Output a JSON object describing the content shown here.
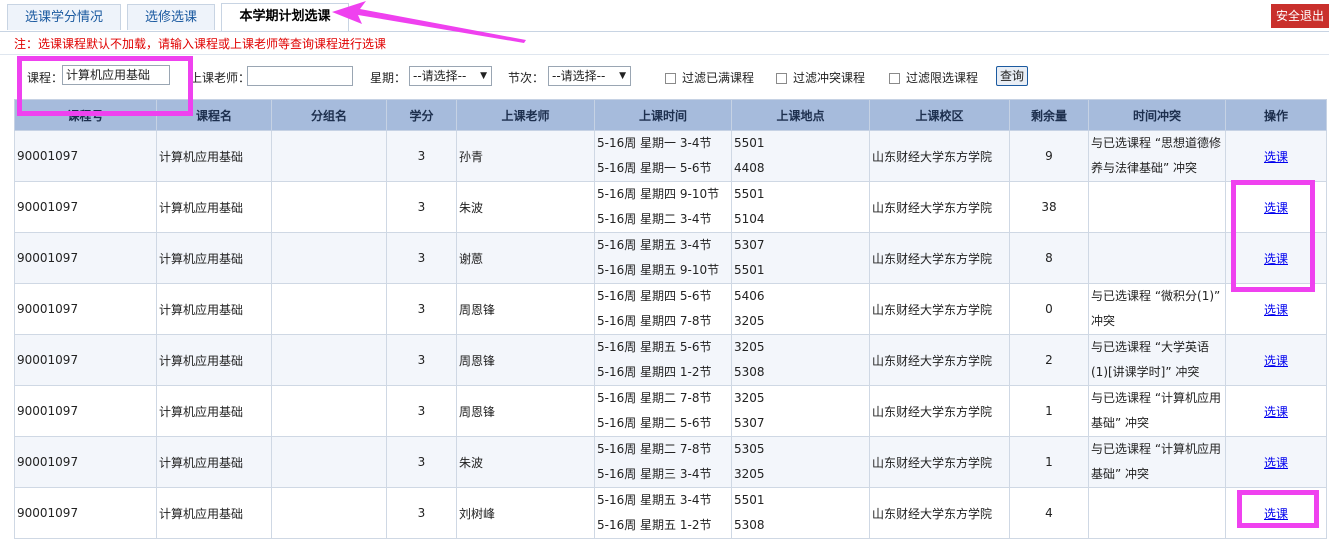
{
  "tabs": [
    {
      "label": "选课学分情况",
      "active": false
    },
    {
      "label": "选修选课",
      "active": false
    },
    {
      "label": "本学期计划选课",
      "active": true
    }
  ],
  "logout_label": "安全退出",
  "notice": "注：选课课程默认不加载，请输入课程或上课老师等查询课程进行选课",
  "filters": {
    "course_label": "课程：",
    "course_value": "计算机应用基础",
    "teacher_label": "上课老师：",
    "teacher_value": "",
    "weekday_label": "星期：",
    "weekday_value": "--请选择--",
    "period_label": "节次：",
    "period_value": "--请选择--",
    "filter_full": "过滤已满课程",
    "filter_conflict": "过滤冲突课程",
    "filter_limited": "过滤限选课程",
    "query_label": "查询"
  },
  "table": {
    "headers": [
      "课程号",
      "课程名",
      "分组名",
      "学分",
      "上课老师",
      "上课时间",
      "上课地点",
      "上课校区",
      "剩余量",
      "时间冲突",
      "操作"
    ],
    "rows": [
      {
        "id": "90001097",
        "name": "计算机应用基础",
        "group": "",
        "credit": "3",
        "teacher": "孙青",
        "time1": "5-16周 星期一 3-4节",
        "time2": "5-16周 星期一 5-6节",
        "room1": "5501",
        "room2": "4408",
        "campus": "山东财经大学东方学院",
        "remain": "9",
        "conflict": "与已选课程 “思想道德修养与法律基础” 冲突",
        "action": "选课"
      },
      {
        "id": "90001097",
        "name": "计算机应用基础",
        "group": "",
        "credit": "3",
        "teacher": "朱波",
        "time1": "5-16周 星期四 9-10节",
        "time2": "5-16周 星期二 3-4节",
        "room1": "5501",
        "room2": "5104",
        "campus": "山东财经大学东方学院",
        "remain": "38",
        "conflict": "",
        "action": "选课"
      },
      {
        "id": "90001097",
        "name": "计算机应用基础",
        "group": "",
        "credit": "3",
        "teacher": "谢蒽",
        "time1": "5-16周 星期五 3-4节",
        "time2": "5-16周 星期五 9-10节",
        "room1": "5307",
        "room2": "5501",
        "campus": "山东财经大学东方学院",
        "remain": "8",
        "conflict": "",
        "action": "选课"
      },
      {
        "id": "90001097",
        "name": "计算机应用基础",
        "group": "",
        "credit": "3",
        "teacher": "周恩锋",
        "time1": "5-16周 星期四 5-6节",
        "time2": "5-16周 星期四 7-8节",
        "room1": "5406",
        "room2": "3205",
        "campus": "山东财经大学东方学院",
        "remain": "0",
        "conflict": "与已选课程 “微积分(1)” 冲突",
        "action": "选课"
      },
      {
        "id": "90001097",
        "name": "计算机应用基础",
        "group": "",
        "credit": "3",
        "teacher": "周恩锋",
        "time1": "5-16周 星期五 5-6节",
        "time2": "5-16周 星期四 1-2节",
        "room1": "3205",
        "room2": "5308",
        "campus": "山东财经大学东方学院",
        "remain": "2",
        "conflict": "与已选课程 “大学英语(1)[讲课学时]” 冲突",
        "action": "选课"
      },
      {
        "id": "90001097",
        "name": "计算机应用基础",
        "group": "",
        "credit": "3",
        "teacher": "周恩锋",
        "time1": "5-16周 星期二 7-8节",
        "time2": "5-16周 星期二 5-6节",
        "room1": "3205",
        "room2": "5307",
        "campus": "山东财经大学东方学院",
        "remain": "1",
        "conflict": "与已选课程 “计算机应用基础” 冲突",
        "action": "选课"
      },
      {
        "id": "90001097",
        "name": "计算机应用基础",
        "group": "",
        "credit": "3",
        "teacher": "朱波",
        "time1": "5-16周 星期二 7-8节",
        "time2": "5-16周 星期三 3-4节",
        "room1": "5305",
        "room2": "3205",
        "campus": "山东财经大学东方学院",
        "remain": "1",
        "conflict": "与已选课程 “计算机应用基础” 冲突",
        "action": "选课"
      },
      {
        "id": "90001097",
        "name": "计算机应用基础",
        "group": "",
        "credit": "3",
        "teacher": "刘树峰",
        "time1": "5-16周 星期五 3-4节",
        "time2": "5-16周 星期五 1-2节",
        "room1": "5501",
        "room2": "5308",
        "campus": "山东财经大学东方学院",
        "remain": "4",
        "conflict": "",
        "action": "选课"
      }
    ]
  },
  "colors": {
    "annotation": "#ef41ef",
    "header_bg": "#a6bbdc",
    "logout_bg": "#c9302c",
    "notice": "#e00000"
  }
}
